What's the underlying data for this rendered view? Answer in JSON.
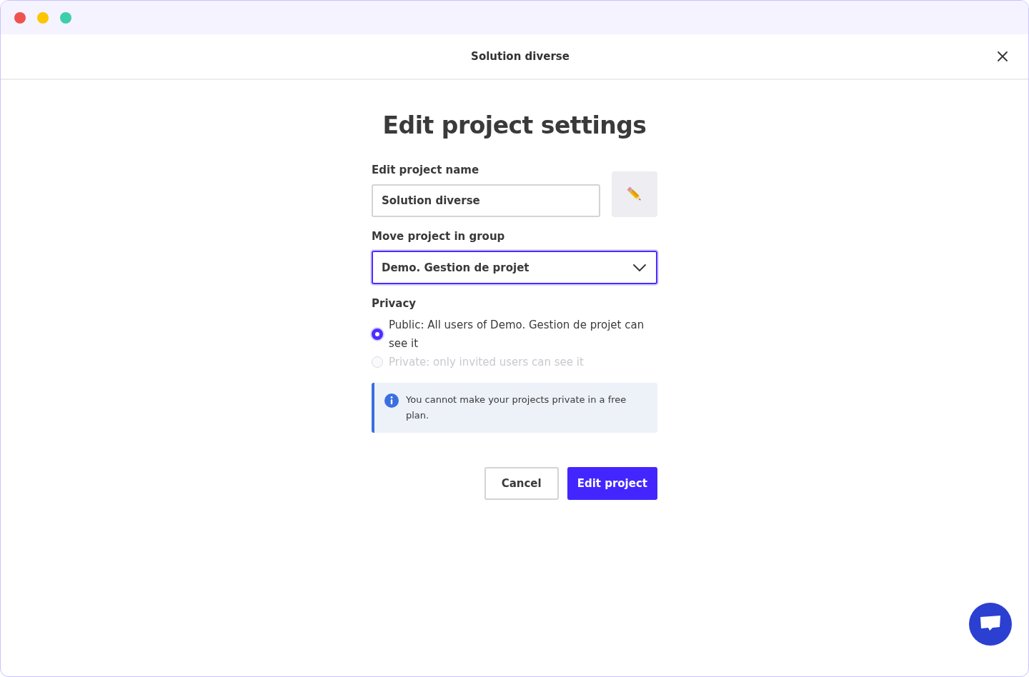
{
  "window": {
    "controls": [
      {
        "color": "#ef5350"
      },
      {
        "color": "#fdc602"
      },
      {
        "color": "#3ccfab"
      }
    ]
  },
  "header": {
    "title": "Solution diverse"
  },
  "heading": "Edit project settings",
  "name_field": {
    "label": "Edit project name",
    "value": "Solution diverse"
  },
  "group_field": {
    "label": "Move project in group",
    "value": "Demo. Gestion de projet",
    "focused": true
  },
  "privacy": {
    "label": "Privacy",
    "options": [
      {
        "label": "Public: All users of Demo. Gestion de projet can see it",
        "selected": true,
        "disabled": false
      },
      {
        "label": "Private: only invited users can see it",
        "selected": false,
        "disabled": true
      }
    ]
  },
  "notice": "You cannot make your projects private in a free plan.",
  "buttons": [
    {
      "label": "Cancel",
      "kind": "secondary"
    },
    {
      "label": "Edit project",
      "kind": "primary"
    }
  ]
}
